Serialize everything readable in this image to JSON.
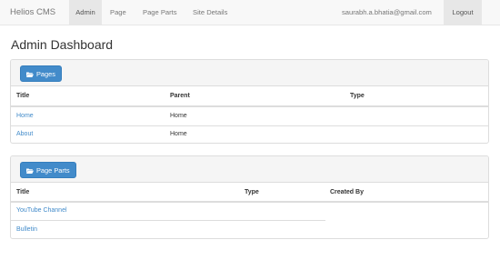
{
  "navbar": {
    "brand": "Helios CMS",
    "items": [
      {
        "label": "Admin",
        "active": true
      },
      {
        "label": "Page"
      },
      {
        "label": "Page Parts"
      },
      {
        "label": "Site Details"
      }
    ],
    "user_email": "saurabh.a.bhatia@gmail.com",
    "logout_label": "Logout"
  },
  "page_title": "Admin Dashboard",
  "pages_panel": {
    "button_label": "Pages",
    "button_icon": "folder-open-icon",
    "columns": [
      "Title",
      "Parent",
      "Type"
    ],
    "rows": [
      {
        "title": "Home",
        "parent": "Home",
        "type": ""
      },
      {
        "title": "About",
        "parent": "Home",
        "type": ""
      }
    ]
  },
  "page_parts_panel": {
    "button_label": "Page Parts",
    "button_icon": "folder-open-icon",
    "columns": [
      "Title",
      "Type",
      "Created By"
    ],
    "rows": [
      {
        "title": "YouTube Channel",
        "type": "",
        "created_by": ""
      },
      {
        "title": "Bulletin",
        "type": "",
        "created_by": ""
      }
    ]
  },
  "colors": {
    "accent": "#428bca",
    "navbar_bg": "#f8f8f8",
    "active_nav_bg": "#e7e7e7",
    "panel_heading_bg": "#f5f5f5"
  }
}
